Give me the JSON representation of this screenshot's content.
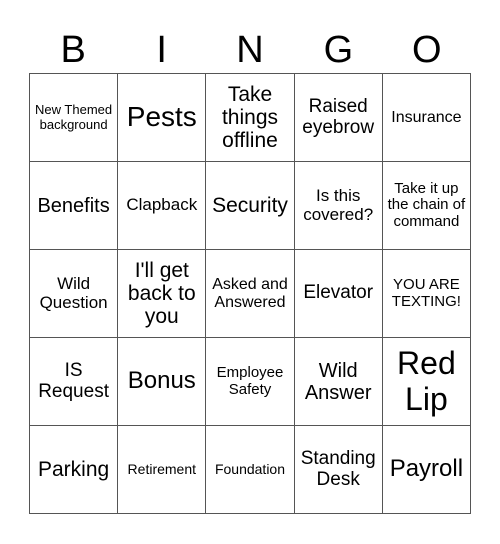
{
  "header": [
    "B",
    "I",
    "N",
    "G",
    "O"
  ],
  "cells": [
    {
      "text": "New Themed background",
      "size": "s13"
    },
    {
      "text": "Pests",
      "size": "s28"
    },
    {
      "text": "Take things offline",
      "size": "s21"
    },
    {
      "text": "Raised eyebrow",
      "size": "s19"
    },
    {
      "text": "Insurance",
      "size": "s16"
    },
    {
      "text": "Benefits",
      "size": "s20"
    },
    {
      "text": "Clapback",
      "size": "s17"
    },
    {
      "text": "Security",
      "size": "s21"
    },
    {
      "text": "Is this covered?",
      "size": "s17"
    },
    {
      "text": "Take it up the chain of command",
      "size": "s15"
    },
    {
      "text": "Wild Question",
      "size": "s17"
    },
    {
      "text": "I'll get back to you",
      "size": "s21"
    },
    {
      "text": "Asked and Answered",
      "size": "s16"
    },
    {
      "text": "Elevator",
      "size": "s19"
    },
    {
      "text": "YOU ARE TEXTING!",
      "size": "s15"
    },
    {
      "text": "IS Request",
      "size": "s19"
    },
    {
      "text": "Bonus",
      "size": "s24"
    },
    {
      "text": "Employee Safety",
      "size": "s15"
    },
    {
      "text": "Wild Answer",
      "size": "s20"
    },
    {
      "text": "Red Lip",
      "size": "s32"
    },
    {
      "text": "Parking",
      "size": "s21"
    },
    {
      "text": "Retirement",
      "size": "s14"
    },
    {
      "text": "Foundation",
      "size": "s14"
    },
    {
      "text": "Standing Desk",
      "size": "s19"
    },
    {
      "text": "Payroll",
      "size": "s24"
    }
  ]
}
